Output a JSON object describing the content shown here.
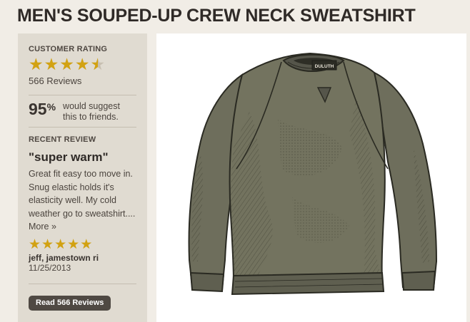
{
  "header": {
    "title": "MEN'S SOUPED-UP CREW NECK SWEATSHIRT"
  },
  "rating": {
    "label": "CUSTOMER RATING",
    "stars": 4.5,
    "reviews_text": "566 Reviews",
    "percent": "95",
    "percent_sign": "%",
    "suggest_text": "would suggest this to friends."
  },
  "recent_review": {
    "label": "RECENT REVIEW",
    "headline": "\"super warm\"",
    "body": "Great fit easy too move in. Snug elastic holds it's elasticity well. My cold weather go to sweatshirt....",
    "more_label": "More »",
    "stars": 5,
    "author": "jeff, jamestown ri",
    "date": "11/25/2013"
  },
  "read_button": {
    "label": "Read 566 Reviews"
  },
  "product_image": {
    "alt": "",
    "tag_text": "DULUTH",
    "colors": {
      "body": "#6e6e5c",
      "shadow": "#3d3d30",
      "outline": "#2a2a22"
    }
  },
  "colors": {
    "star": "#d2a212",
    "sidebar": "#e0dbd1",
    "page": "#f1ede6",
    "button": "#4f4943"
  }
}
